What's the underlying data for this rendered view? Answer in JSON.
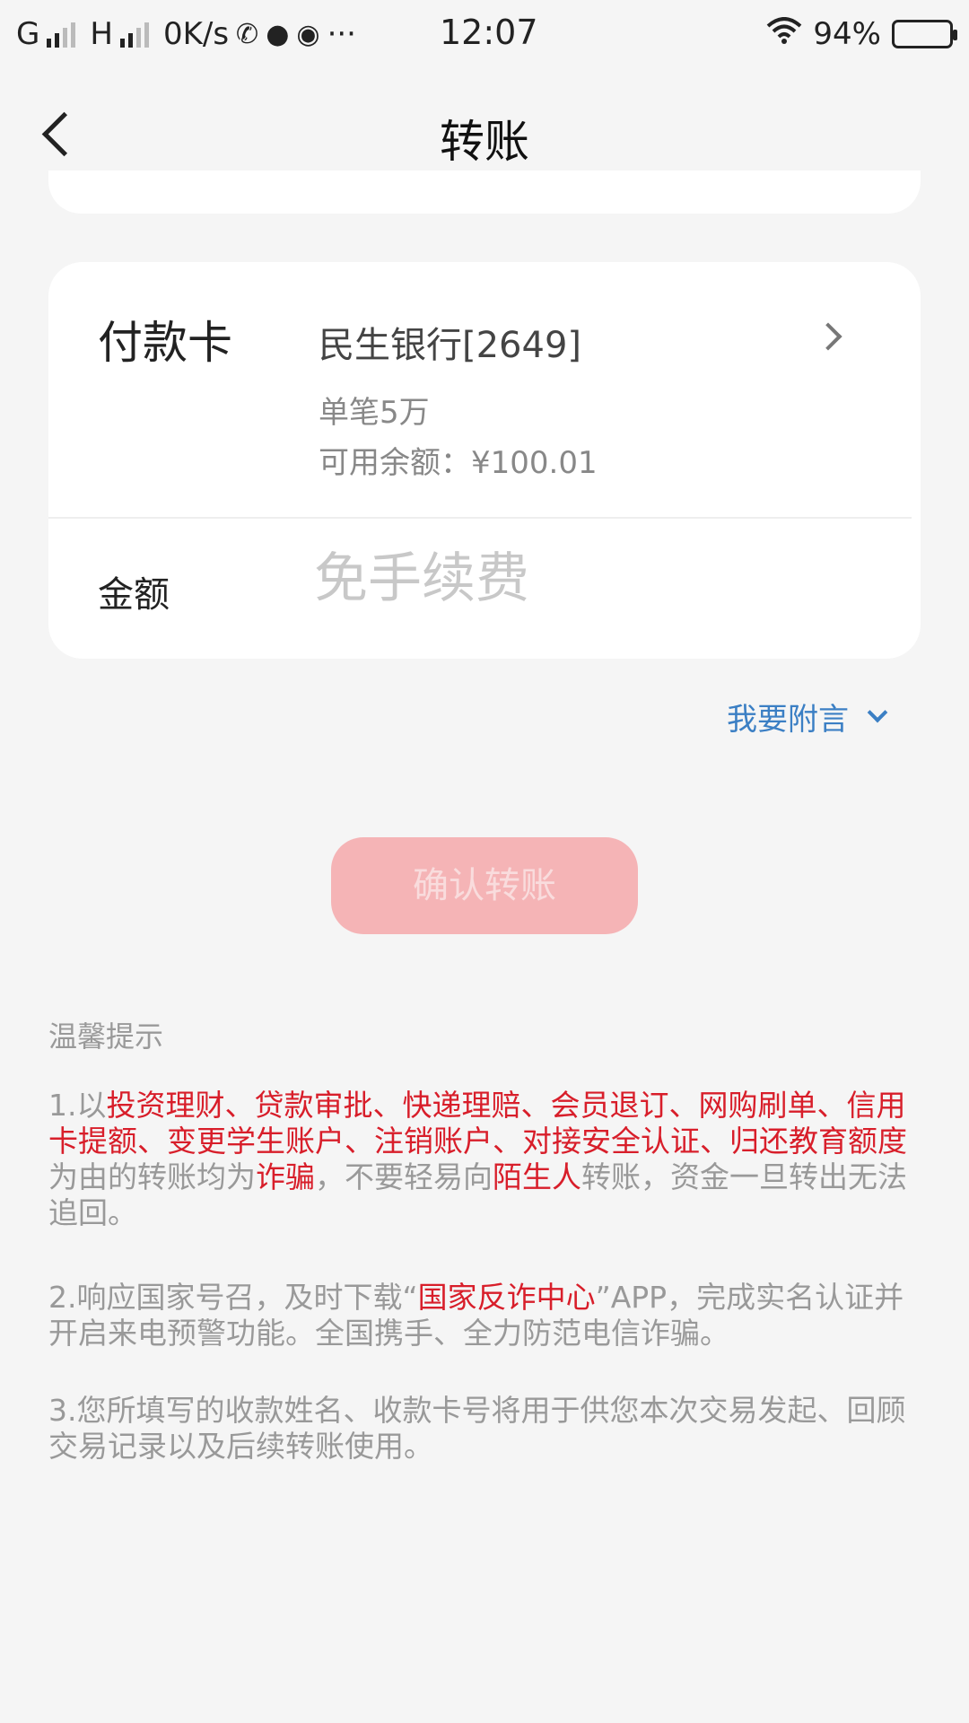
{
  "status_bar": {
    "carrier1": "G",
    "carrier2": "H",
    "speed": "0K/s",
    "more": "···",
    "time": "12:07",
    "battery": "94%",
    "battery_level": 0.94
  },
  "nav": {
    "title": "转账"
  },
  "pay_card": {
    "label": "付款卡",
    "bank": "民生银行[2649]",
    "limit": "单笔5万",
    "balance": "可用余额：¥100.01"
  },
  "amount": {
    "label": "金额",
    "placeholder": "免手续费",
    "value": ""
  },
  "note_link": {
    "label": "我要附言"
  },
  "confirm": {
    "label": "确认转账"
  },
  "tips": {
    "title": "温馨提示",
    "tip1": {
      "prefix": "1.以",
      "scams": "投资理财、贷款审批、快递理赔、会员退订、网购刷单、信用卡提额、变更学生账户、注销账户、对接安全认证、归还教育额度",
      "mid1": "为由的转账均为",
      "fraud": "诈骗",
      "mid2": "，不要轻易向",
      "stranger": "陌生人",
      "suffix": "转账，资金一旦转出无法追回。"
    },
    "tip2": {
      "prefix": "2.响应国家号召，及时下载“",
      "app": "国家反诈中心",
      "suffix": "”APP，完成实名认证并开启来电预警功能。全国携手、全力防范电信诈骗。"
    },
    "tip3": {
      "text": "3.您所填写的收款姓名、收款卡号将用于供您本次交易发起、回顾交易记录以及后续转账使用。"
    }
  }
}
